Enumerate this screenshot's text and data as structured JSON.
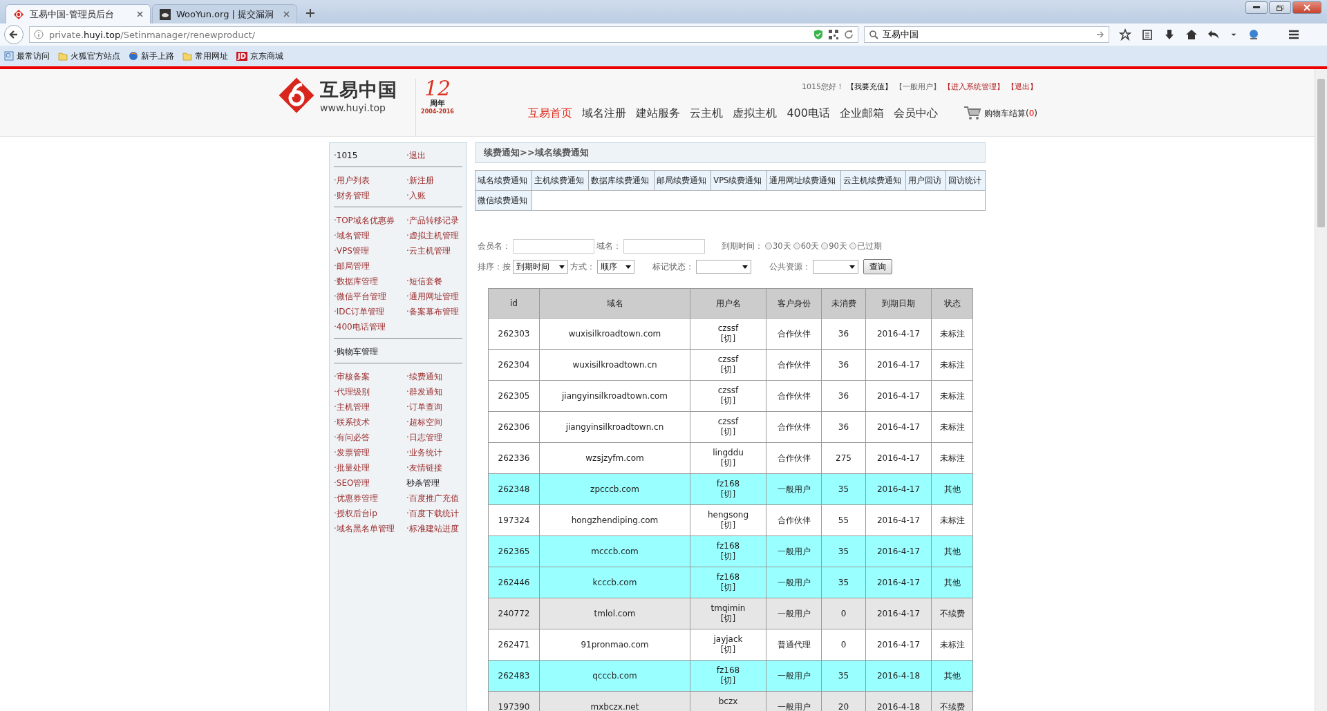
{
  "browser": {
    "tabs": [
      {
        "title": "互易中国-管理员后台",
        "selected": true
      },
      {
        "title": "WooYun.org | 提交漏洞",
        "selected": false
      }
    ],
    "url": {
      "before": "private.",
      "host": "huyi.top",
      "after": "/Setinmanager/renewproduct/"
    },
    "search": {
      "value": "互易中国"
    },
    "bookmarks": [
      {
        "label": "最常访问"
      },
      {
        "label": "火狐官方站点"
      },
      {
        "label": "新手上路"
      },
      {
        "label": "常用网址"
      },
      {
        "label": "京东商城",
        "badge": "JD"
      }
    ]
  },
  "header": {
    "logo": {
      "name": "互易中国",
      "url": "www.huyi.top"
    },
    "anniversary": {
      "number": "12",
      "label": "周年",
      "years": "2004-2016"
    },
    "greeting": "1015您好！",
    "top_links": [
      {
        "label": "【我要充值】",
        "kind": "strong"
      },
      {
        "label": "【一般用户】",
        "kind": "muted"
      },
      {
        "label": "【进入系统管理】",
        "kind": "alert"
      },
      {
        "label": "【退出】",
        "kind": "alert"
      }
    ],
    "nav": [
      {
        "label": "互易首页",
        "selected": true
      },
      {
        "label": "域名注册",
        "selected": false
      },
      {
        "label": "建站服务",
        "selected": false
      },
      {
        "label": "云主机",
        "selected": false
      },
      {
        "label": "虚拟主机",
        "selected": false
      },
      {
        "label": "400电话",
        "selected": false
      },
      {
        "label": "企业邮箱",
        "selected": false
      },
      {
        "label": "会员中心",
        "selected": false
      }
    ],
    "cart": {
      "label": "购物车结算(",
      "count": "0",
      "suffix": ")"
    }
  },
  "sidebar": {
    "groups": [
      {
        "rows": [
          [
            {
              "label": "·1015",
              "kind": "text"
            },
            {
              "label": "·退出",
              "kind": "link"
            }
          ]
        ]
      },
      {
        "rows": [
          [
            {
              "label": "·用户列表",
              "kind": "link"
            },
            {
              "label": "·新注册",
              "kind": "link"
            }
          ],
          [
            {
              "label": "·财务管理",
              "kind": "link"
            },
            {
              "label": "·入账",
              "kind": "link"
            }
          ]
        ]
      },
      {
        "rows": [
          [
            {
              "label": "·TOP域名优惠券",
              "kind": "link"
            },
            {
              "label": "·产品转移记录",
              "kind": "link"
            }
          ],
          [
            {
              "label": "·域名管理",
              "kind": "link"
            },
            {
              "label": "·虚拟主机管理",
              "kind": "link"
            }
          ],
          [
            {
              "label": "·VPS管理",
              "kind": "link"
            },
            {
              "label": "·云主机管理",
              "kind": "link"
            }
          ],
          [
            {
              "label": "·邮局管理",
              "kind": "link"
            }
          ],
          [
            {
              "label": "·数据库管理",
              "kind": "link"
            },
            {
              "label": "·短信套餐",
              "kind": "link"
            }
          ],
          [
            {
              "label": "·微信平台管理",
              "kind": "link"
            },
            {
              "label": "·通用网址管理",
              "kind": "link"
            }
          ],
          [
            {
              "label": "·IDC订单管理",
              "kind": "link"
            },
            {
              "label": "·备案幕布管理",
              "kind": "link"
            }
          ],
          [
            {
              "label": "·400电话管理",
              "kind": "link"
            }
          ]
        ]
      },
      {
        "rows": [
          [
            {
              "label": "·购物车管理",
              "kind": "text"
            }
          ]
        ]
      },
      {
        "rows": [
          [
            {
              "label": "·审核备案",
              "kind": "link"
            },
            {
              "label": "·续费通知",
              "kind": "link"
            }
          ],
          [
            {
              "label": "·代理级别",
              "kind": "link"
            },
            {
              "label": "·群发通知",
              "kind": "link"
            }
          ],
          [
            {
              "label": "·主机管理",
              "kind": "link"
            },
            {
              "label": "·订单查询",
              "kind": "link"
            }
          ],
          [
            {
              "label": "·联系技术",
              "kind": "link"
            },
            {
              "label": "·超标空间",
              "kind": "link"
            }
          ],
          [
            {
              "label": "·有问必答",
              "kind": "link"
            },
            {
              "label": "·日志管理",
              "kind": "link"
            }
          ],
          [
            {
              "label": "·发票管理",
              "kind": "link"
            },
            {
              "label": "·业务统计",
              "kind": "link"
            }
          ],
          [
            {
              "label": "·批量处理",
              "kind": "link"
            },
            {
              "label": "·友情链接",
              "kind": "link"
            }
          ],
          [
            {
              "label": "·SEO管理",
              "kind": "link"
            },
            {
              "label": "秒杀管理",
              "kind": "text"
            }
          ],
          [
            {
              "label": "·优惠券管理",
              "kind": "link"
            },
            {
              "label": "·百度推广充值",
              "kind": "link"
            }
          ],
          [
            {
              "label": "·授权后台ip",
              "kind": "link"
            },
            {
              "label": "·百度下载统计",
              "kind": "link"
            }
          ],
          [
            {
              "label": "·域名黑名单管理",
              "kind": "link"
            },
            {
              "label": "·标准建站进度",
              "kind": "link"
            }
          ]
        ]
      }
    ]
  },
  "breadcrumb": "续费通知>>域名续费通知",
  "notice_tabs": [
    "域名续费通知",
    "主机续费通知",
    "数据库续费通知",
    "邮局续费通知",
    "VPS续费通知",
    "通用网址续费通知",
    "云主机续费通知",
    "用户回访",
    "回访统计",
    "微信续费通知"
  ],
  "filters": {
    "member_label": "会员名：",
    "domain_label": "域名：",
    "expiry_label": "到期时间：",
    "expiry_options": [
      {
        "label": "30天",
        "selected": false
      },
      {
        "label": "60天",
        "selected": false
      },
      {
        "label": "90天",
        "selected": false
      },
      {
        "label": "已过期",
        "selected": false
      }
    ],
    "sort_label": "排序：按",
    "sort_value": "到期时间",
    "order_label": "方式：",
    "order_value": "顺序",
    "mark_label": "标记状态：",
    "public_label": "公共资源：",
    "query_button": "查询"
  },
  "table": {
    "columns": [
      "id",
      "域名",
      "用户名",
      "客户身份",
      "未消费",
      "到期日期",
      "状态"
    ],
    "rows": [
      {
        "id": "262303",
        "domain": "wuxisilkroadtown.com",
        "user": "czssf",
        "switch": "[切]",
        "role": "合作伙伴",
        "unspent": "36",
        "expires": "2016-4-17",
        "status": "未标注",
        "color": "#ffffff"
      },
      {
        "id": "262304",
        "domain": "wuxisilkroadtown.cn",
        "user": "czssf",
        "switch": "[切]",
        "role": "合作伙伴",
        "unspent": "36",
        "expires": "2016-4-17",
        "status": "未标注",
        "color": "#ffffff"
      },
      {
        "id": "262305",
        "domain": "jiangyinsilkroadtown.com",
        "user": "czssf",
        "switch": "[切]",
        "role": "合作伙伴",
        "unspent": "36",
        "expires": "2016-4-17",
        "status": "未标注",
        "color": "#ffffff"
      },
      {
        "id": "262306",
        "domain": "jiangyinsilkroadtown.cn",
        "user": "czssf",
        "switch": "[切]",
        "role": "合作伙伴",
        "unspent": "36",
        "expires": "2016-4-17",
        "status": "未标注",
        "color": "#ffffff"
      },
      {
        "id": "262336",
        "domain": "wzsjzyfm.com",
        "user": "lingddu",
        "switch": "[切]",
        "role": "合作伙伴",
        "unspent": "275",
        "expires": "2016-4-17",
        "status": "未标注",
        "color": "#ffffff"
      },
      {
        "id": "262348",
        "domain": "zpcccb.com",
        "user": "fz168",
        "switch": "[切]",
        "role": "一般用户",
        "unspent": "35",
        "expires": "2016-4-17",
        "status": "其他",
        "color": "#99ffff"
      },
      {
        "id": "197324",
        "domain": "hongzhendiping.com",
        "user": "hengsong",
        "switch": "[切]",
        "role": "合作伙伴",
        "unspent": "55",
        "expires": "2016-4-17",
        "status": "未标注",
        "color": "#ffffff"
      },
      {
        "id": "262365",
        "domain": "mcccb.com",
        "user": "fz168",
        "switch": "[切]",
        "role": "一般用户",
        "unspent": "35",
        "expires": "2016-4-17",
        "status": "其他",
        "color": "#99ffff"
      },
      {
        "id": "262446",
        "domain": "kcccb.com",
        "user": "fz168",
        "switch": "[切]",
        "role": "一般用户",
        "unspent": "35",
        "expires": "2016-4-17",
        "status": "其他",
        "color": "#99ffff"
      },
      {
        "id": "240772",
        "domain": "tmlol.com",
        "user": "tmqimin",
        "switch": "[切]",
        "role": "一般用户",
        "unspent": "0",
        "expires": "2016-4-17",
        "status": "不续费",
        "color": "#e6e6e6"
      },
      {
        "id": "262471",
        "domain": "91pronmao.com",
        "user": "jayjack",
        "switch": "[切]",
        "role": "普通代理",
        "unspent": "0",
        "expires": "2016-4-17",
        "status": "未标注",
        "color": "#ffffff"
      },
      {
        "id": "262483",
        "domain": "qcccb.com",
        "user": "fz168",
        "switch": "[切]",
        "role": "一般用户",
        "unspent": "35",
        "expires": "2016-4-18",
        "status": "其他",
        "color": "#99ffff"
      },
      {
        "id": "197390",
        "domain": "mxbczx.net",
        "user": "bczx",
        "role": "一般用户",
        "unspent": "20",
        "expires": "2016-4-18",
        "status": "不续费",
        "color": "#e6e6e6"
      }
    ]
  }
}
